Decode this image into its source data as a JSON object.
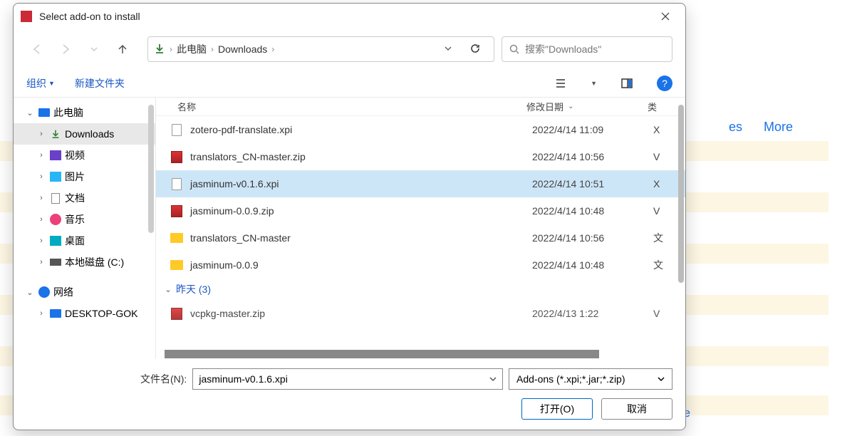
{
  "dialog": {
    "title": "Select add-on to install",
    "path": {
      "root": "此电脑",
      "folder": "Downloads"
    },
    "search_placeholder": "搜索\"Downloads\"",
    "toolbar": {
      "organize": "组织",
      "new_folder": "新建文件夹"
    },
    "columns": {
      "name": "名称",
      "date": "修改日期",
      "type": "类"
    },
    "sidebar": {
      "this_pc": "此电脑",
      "downloads": "Downloads",
      "videos": "视频",
      "pictures": "图片",
      "documents": "文档",
      "music": "音乐",
      "desktop": "桌面",
      "local_disk": "本地磁盘 (C:)",
      "network": "网络",
      "desktop_host": "DESKTOP-GOK"
    },
    "files": [
      {
        "name": "zotero-pdf-translate.xpi",
        "date": "2022/4/14 11:09",
        "type": "X",
        "icon": "file"
      },
      {
        "name": "translators_CN-master.zip",
        "date": "2022/4/14 10:56",
        "type": "V",
        "icon": "zip"
      },
      {
        "name": "jasminum-v0.1.6.xpi",
        "date": "2022/4/14 10:51",
        "type": "X",
        "icon": "file",
        "selected": true
      },
      {
        "name": "jasminum-0.0.9.zip",
        "date": "2022/4/14 10:48",
        "type": "V",
        "icon": "zip"
      },
      {
        "name": "translators_CN-master",
        "date": "2022/4/14 10:56",
        "type": "文",
        "icon": "folder"
      },
      {
        "name": "jasminum-0.0.9",
        "date": "2022/4/14 10:48",
        "type": "文",
        "icon": "folder"
      }
    ],
    "group_yesterday": "昨天 (3)",
    "partial_file": {
      "name": "vcpkg-master.zip",
      "date": "2022/4/13 1:22",
      "type": "V"
    },
    "filename_label": "文件名(N):",
    "filename_value": "jasminum-v0.1.6.xpi",
    "filter": "Add-ons (*.xpi;*.jar;*.zip)",
    "open_btn": "打开(O)",
    "cancel_btn": "取消"
  },
  "background": {
    "tab_es": "es",
    "tab_more": "More",
    "text_re": "re"
  }
}
